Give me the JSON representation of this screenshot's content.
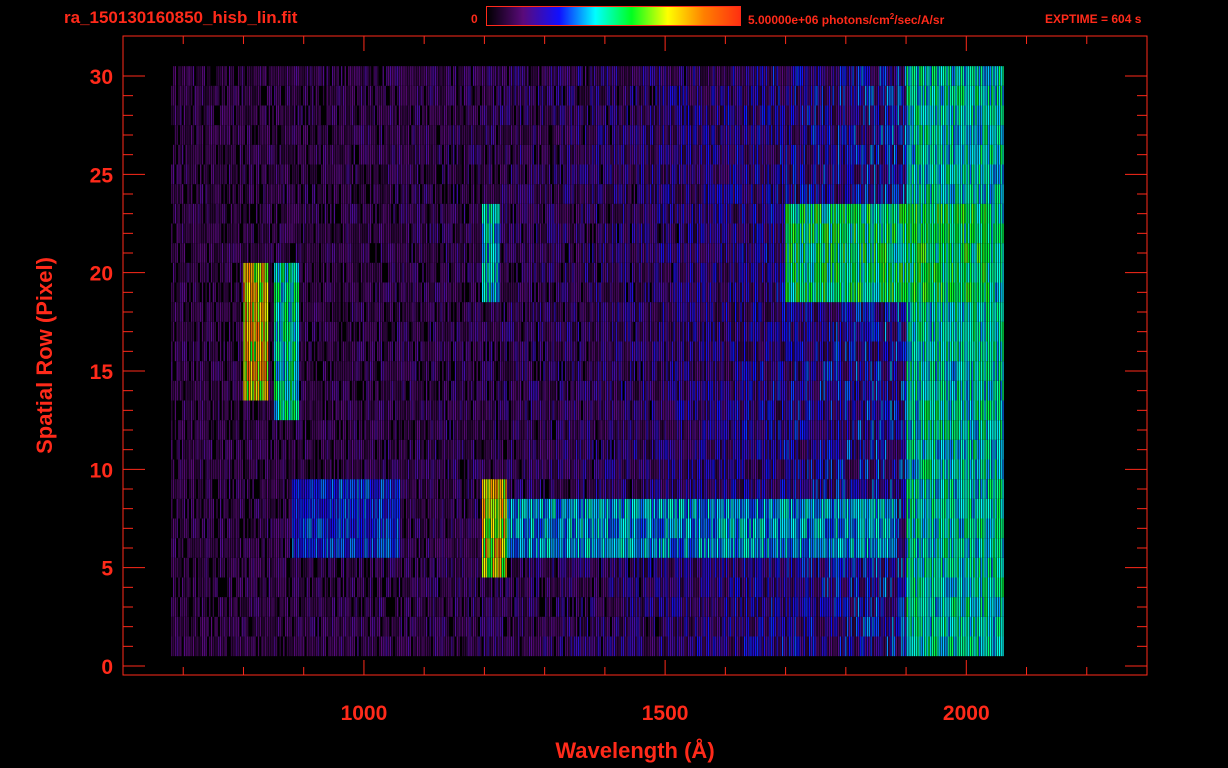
{
  "header": {
    "file_title": "ra_150130160850_hisb_lin.fit",
    "colorbar_min": "0",
    "colorbar_max_prefix": "5.00000e+06 photons/cm",
    "colorbar_max_sup": "2",
    "colorbar_max_suffix": "/sec/A/sr",
    "exptime": "EXPTIME = 604 s"
  },
  "colors": {
    "text": "#ff2a1a",
    "background": "#000000",
    "colormap": [
      "#000000",
      "#5a0a7a",
      "#1010ff",
      "#00ffff",
      "#00ff20",
      "#ffff00",
      "#ff8000",
      "#ff3010"
    ]
  },
  "chart_data": {
    "type": "heatmap",
    "xlabel": "Wavelength (Å)",
    "ylabel": "Spatial Row (Pixel)",
    "xlim": [
      600,
      2300
    ],
    "ylim": [
      0,
      30
    ],
    "xticks": [
      1000,
      1500,
      2000
    ],
    "yticks": [
      0,
      5,
      10,
      15,
      20,
      25,
      30
    ],
    "x_minor_step": 100,
    "y_minor_step": 1,
    "colorbar_range": [
      0,
      5000000
    ],
    "colorbar_units": "photons/cm^2/sec/A/sr",
    "data_x_range": [
      680,
      2060
    ],
    "data_y_range": [
      1,
      30
    ],
    "features": [
      {
        "x_range": [
          800,
          840
        ],
        "y_range": [
          14,
          20
        ],
        "level": 0.8
      },
      {
        "x_range": [
          850,
          890
        ],
        "y_range": [
          13,
          20
        ],
        "level": 0.5
      },
      {
        "x_range": [
          1195,
          1235
        ],
        "y_range": [
          5,
          9
        ],
        "level": 0.78
      },
      {
        "x_range": [
          1195,
          1225
        ],
        "y_range": [
          19,
          23
        ],
        "level": 0.45
      },
      {
        "x_range": [
          1230,
          1880
        ],
        "y_range": [
          6,
          8
        ],
        "level": 0.42
      },
      {
        "x_range": [
          1700,
          2040
        ],
        "y_range": [
          19,
          23
        ],
        "level": 0.55
      },
      {
        "x_range": [
          1900,
          2060
        ],
        "y_range": [
          1,
          30
        ],
        "level": 0.48
      },
      {
        "x_range": [
          880,
          1060
        ],
        "y_range": [
          6,
          9
        ],
        "level": 0.32
      }
    ]
  }
}
